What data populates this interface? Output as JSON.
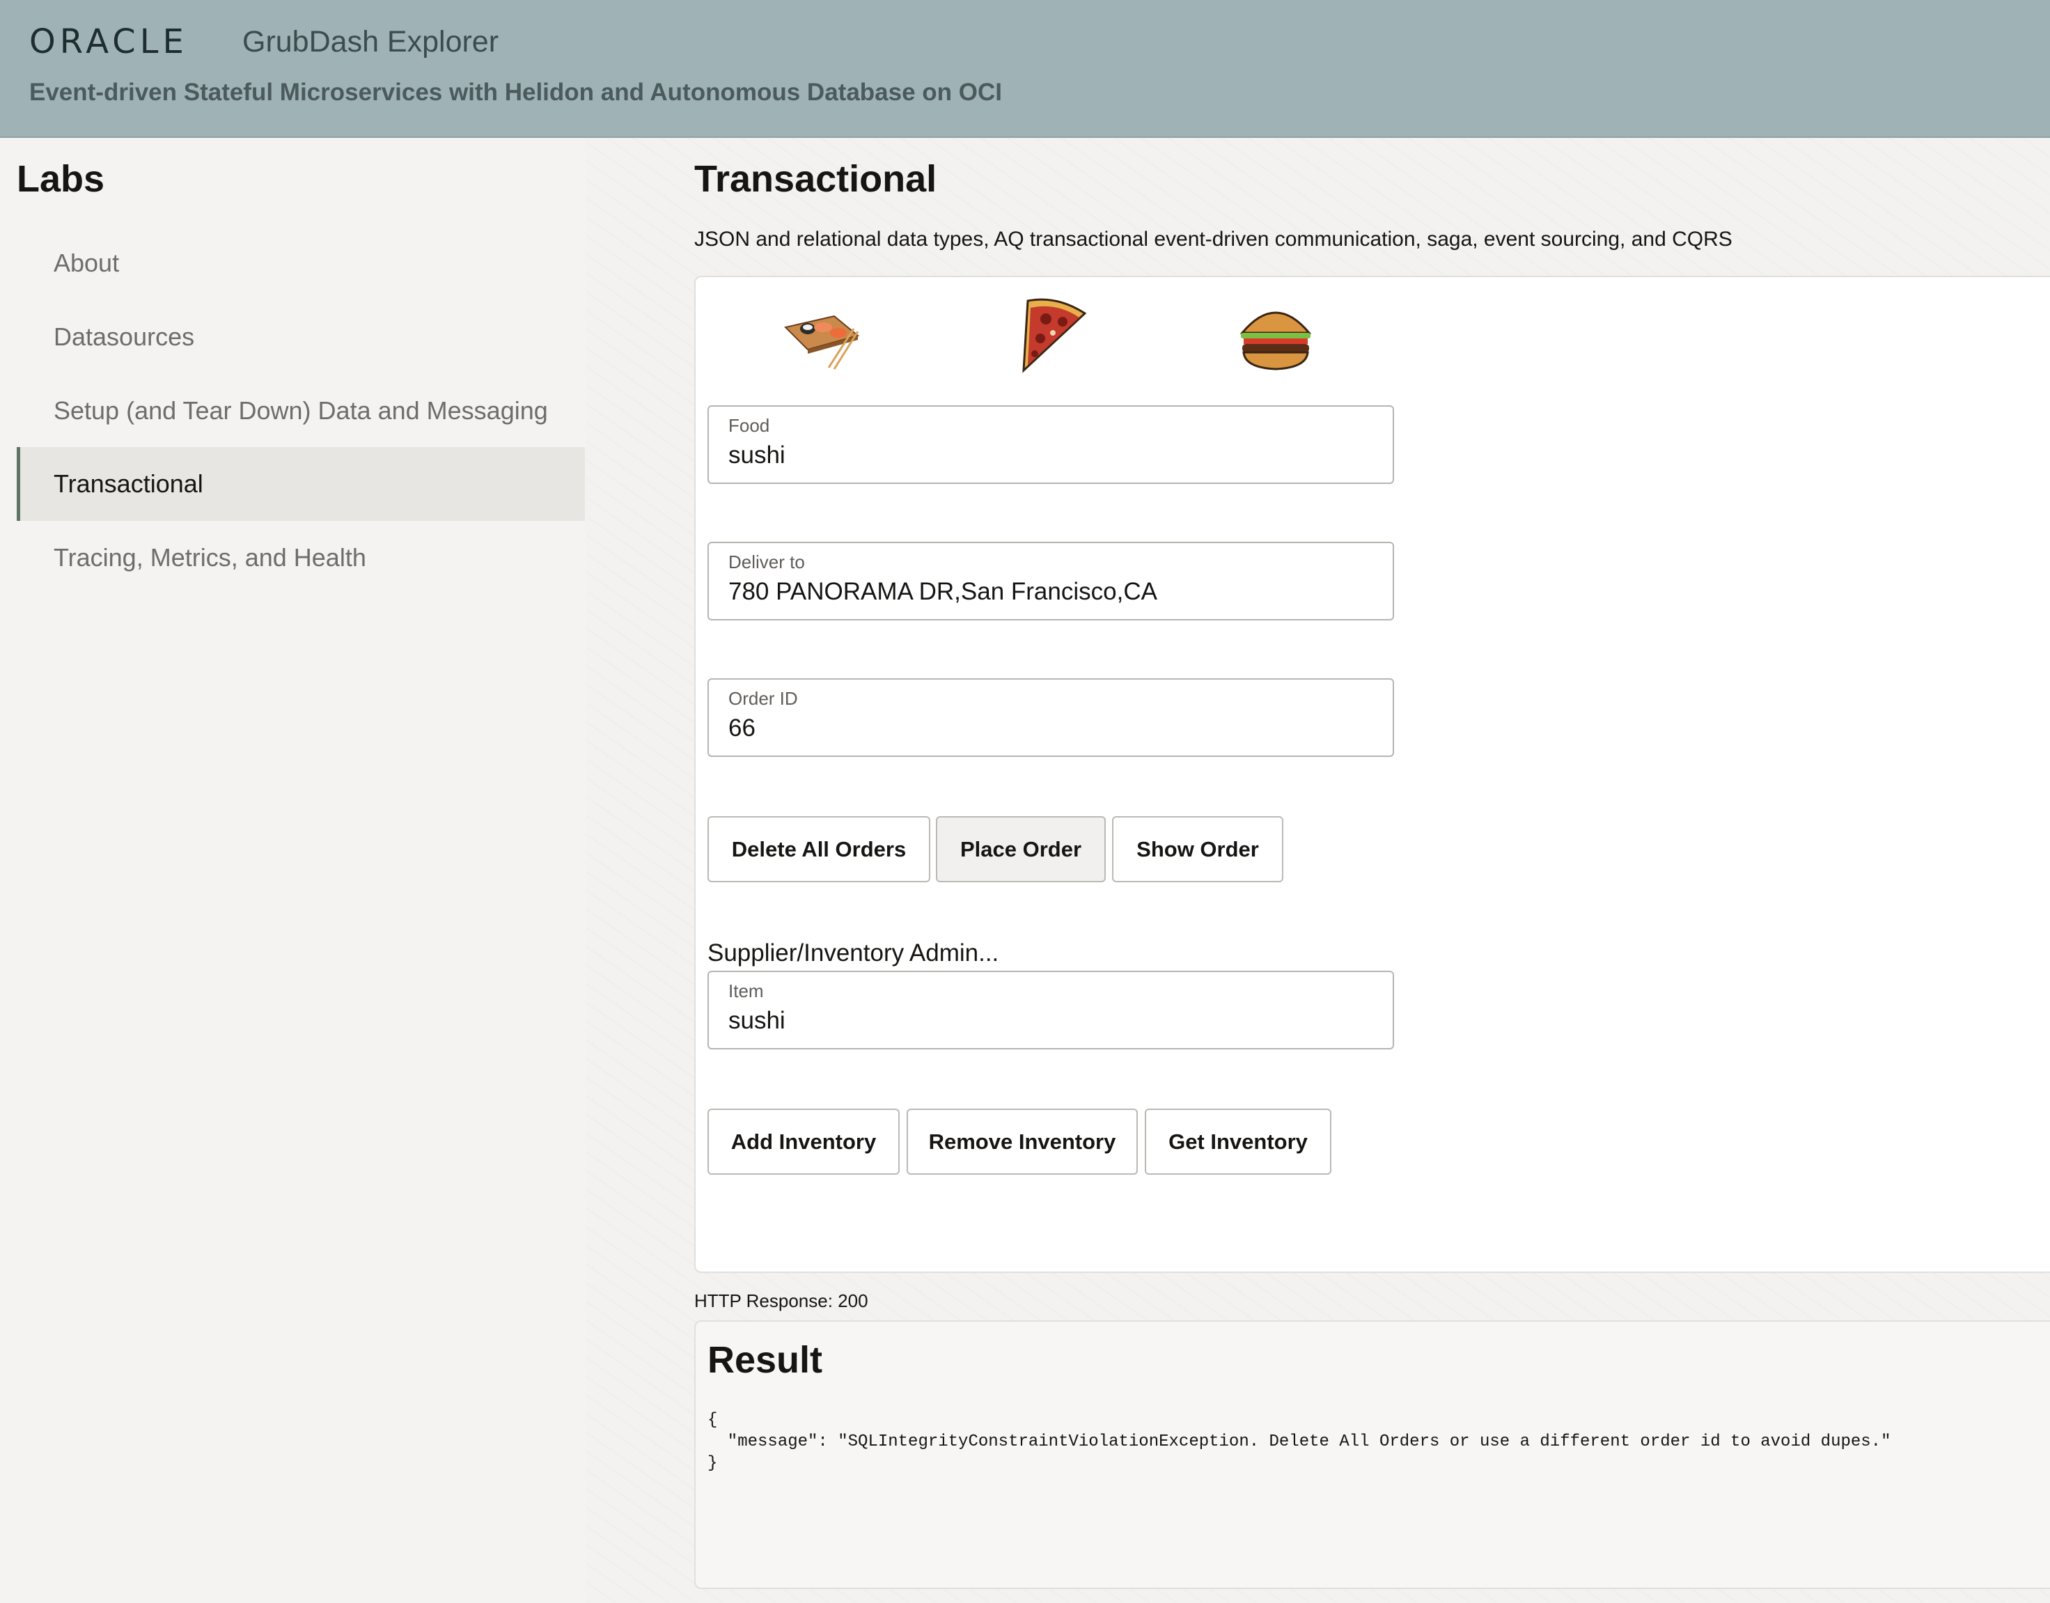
{
  "header": {
    "logo": "ORACLE",
    "app_title": "GrubDash Explorer",
    "subtitle": "Event-driven Stateful Microservices with Helidon and Autonomous Database on OCI"
  },
  "sidebar": {
    "heading": "Labs",
    "items": [
      {
        "label": "About",
        "active": false
      },
      {
        "label": "Datasources",
        "active": false
      },
      {
        "label": "Setup (and Tear Down) Data and Messaging",
        "active": false
      },
      {
        "label": "Transactional",
        "active": true
      },
      {
        "label": "Tracing, Metrics, and Health",
        "active": false
      }
    ]
  },
  "main": {
    "title": "Transactional",
    "description": "JSON and relational data types, AQ transactional event-driven communication, saga, event sourcing, and CQRS",
    "food_icons": [
      "sushi-icon",
      "pizza-icon",
      "burger-icon"
    ],
    "fields": {
      "food": {
        "label": "Food",
        "value": "sushi"
      },
      "deliver_to": {
        "label": "Deliver to",
        "value": "780 PANORAMA DR,San Francisco,CA"
      },
      "order_id": {
        "label": "Order ID",
        "value": "66"
      },
      "item": {
        "label": "Item",
        "value": "sushi"
      }
    },
    "order_buttons": {
      "delete_all": "Delete All Orders",
      "place": "Place Order",
      "show": "Show Order"
    },
    "supplier_label": "Supplier/Inventory Admin...",
    "inventory_buttons": {
      "add": "Add Inventory",
      "remove": "Remove Inventory",
      "get": "Get Inventory"
    },
    "http_status": "HTTP Response: 200",
    "result": {
      "title": "Result",
      "body": "{\n  \"message\": \"SQLIntegrityConstraintViolationException. Delete All Orders or use a different order id to avoid dupes.\"\n}"
    }
  },
  "colors": {
    "header_bg": "#9fb2b6",
    "active_nav_border": "#5e7565",
    "active_nav_bg": "#e7e6e3"
  }
}
